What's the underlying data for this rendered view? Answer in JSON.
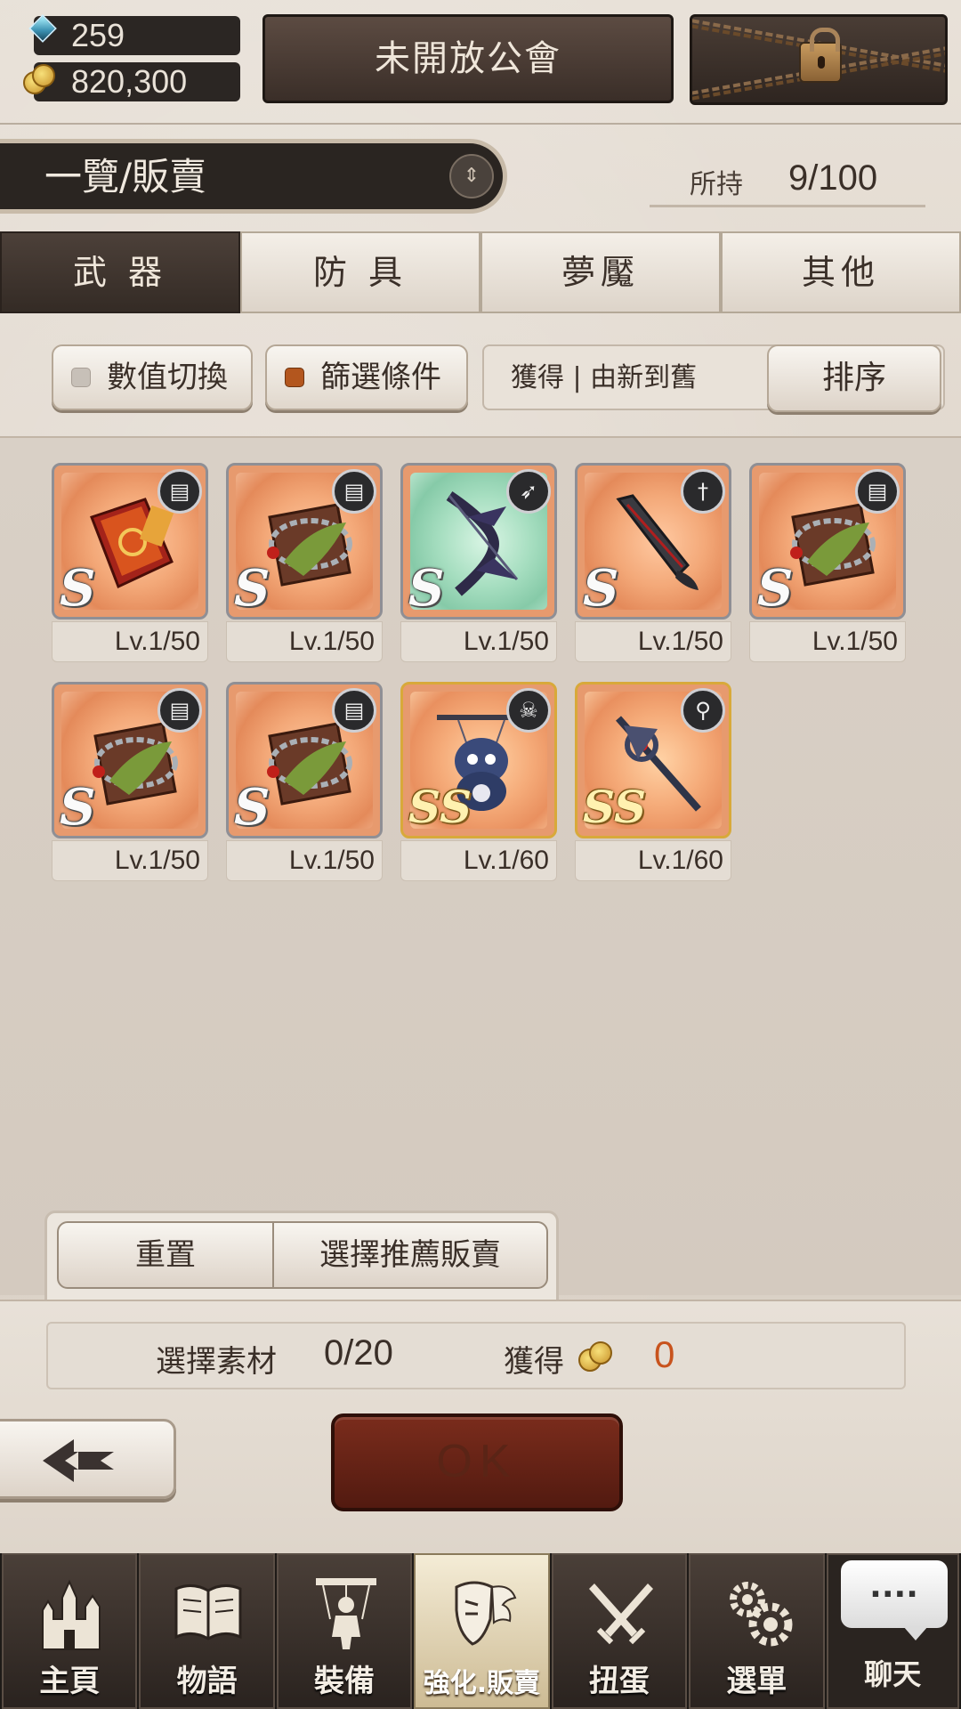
{
  "currency": {
    "gems": "259",
    "coins": "820,300"
  },
  "header": {
    "guild_button": "未開放公會",
    "locked_button": "locked"
  },
  "title_bar": {
    "title": "一覽/販賣",
    "holding_label": "所持",
    "holding_value": "9/100"
  },
  "tabs": [
    {
      "label": "武 器",
      "active": true
    },
    {
      "label": "防 具",
      "active": false
    },
    {
      "label": "夢魘",
      "active": false
    },
    {
      "label": "其他",
      "active": false
    }
  ],
  "filters": {
    "value_toggle": "數值切換",
    "filter_conditions": "篩選條件",
    "sort_text": "獲得 | 由新到舊",
    "sort_button": "排序"
  },
  "items": [
    {
      "rank": "S",
      "level": "Lv.1/50",
      "type_icon": "book-icon",
      "bg": "orange",
      "art": "red-tome"
    },
    {
      "rank": "S",
      "level": "Lv.1/50",
      "type_icon": "book-icon",
      "bg": "orange",
      "art": "chained-tome"
    },
    {
      "rank": "S",
      "level": "Lv.1/50",
      "type_icon": "bow-icon",
      "bg": "green",
      "art": "dark-bow"
    },
    {
      "rank": "S",
      "level": "Lv.1/50",
      "type_icon": "sword-icon",
      "bg": "orange",
      "art": "dark-blade"
    },
    {
      "rank": "S",
      "level": "Lv.1/50",
      "type_icon": "book-icon",
      "bg": "orange",
      "art": "chained-tome"
    },
    {
      "rank": "S",
      "level": "Lv.1/50",
      "type_icon": "book-icon",
      "bg": "orange",
      "art": "chained-tome"
    },
    {
      "rank": "S",
      "level": "Lv.1/50",
      "type_icon": "book-icon",
      "bg": "orange",
      "art": "chained-tome"
    },
    {
      "rank": "SS",
      "level": "Lv.1/60",
      "type_icon": "puppet-icon",
      "bg": "gold",
      "art": "puppet-bear"
    },
    {
      "rank": "SS",
      "level": "Lv.1/60",
      "type_icon": "staff-icon",
      "bg": "gold",
      "art": "dark-staff"
    }
  ],
  "actions": {
    "reset": "重置",
    "recommend_sell": "選擇推薦販賣"
  },
  "summary": {
    "materials_label": "選擇素材",
    "materials_value": "0/20",
    "gain_label": "獲得",
    "gain_value": "0"
  },
  "ok_button": "OK",
  "nav": [
    {
      "label": "主頁",
      "icon": "castle-icon",
      "active": false
    },
    {
      "label": "物語",
      "icon": "open-book-icon",
      "active": false
    },
    {
      "label": "裝備",
      "icon": "puppet-strings-icon",
      "active": false
    },
    {
      "label": "強化.販賣",
      "icon": "mask-wing-icon",
      "active": true
    },
    {
      "label": "扭蛋",
      "icon": "crossed-swords-icon",
      "active": false
    },
    {
      "label": "選單",
      "icon": "gears-icon",
      "active": false
    }
  ],
  "chat": {
    "bubble": "....",
    "label": "聊天"
  },
  "colors": {
    "accent_orange": "#c8531d",
    "ok_red": "#6a2416",
    "dark_panel": "#2b2623"
  }
}
